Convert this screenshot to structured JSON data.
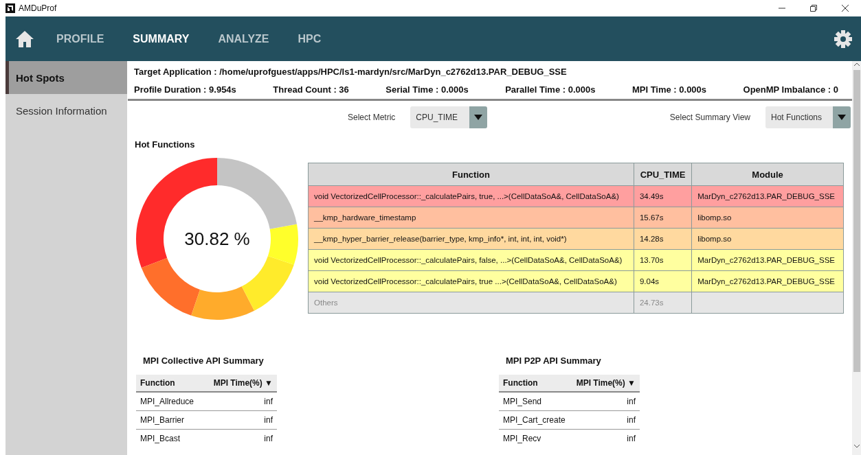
{
  "window": {
    "title": "AMDuProf"
  },
  "nav": {
    "tabs": [
      {
        "label": "PROFILE",
        "selected": false
      },
      {
        "label": "SUMMARY",
        "selected": true
      },
      {
        "label": "ANALYZE",
        "selected": false
      },
      {
        "label": "HPC",
        "selected": false
      }
    ]
  },
  "sidebar": {
    "items": [
      {
        "label": "Hot Spots",
        "selected": true
      },
      {
        "label": "Session Information",
        "selected": false
      }
    ]
  },
  "header": {
    "target": "Target Application : /home/uprofguest/apps/HPC/ls1-mardyn/src/MarDyn_c2762d13.PAR_DEBUG_SSE",
    "stats": [
      "Profile Duration : 9.954s",
      "Thread Count : 36",
      "Serial Time : 0.000s",
      "Parallel Time : 0.000s",
      "MPI Time : 0.000s",
      "OpenMP Imbalance : 0"
    ]
  },
  "metric": {
    "label": "Select Metric",
    "value": "CPU_TIME"
  },
  "summary_view": {
    "label": "Select Summary View",
    "value": "Hot Functions"
  },
  "hot_functions": {
    "title": "Hot Functions",
    "center_label": "30.82 %",
    "chart_data": {
      "type": "donut",
      "values": [
        30.82,
        14.0,
        12.76,
        12.24,
        8.08,
        22.1
      ],
      "colors": [
        "#ff2b2b",
        "#ff6f2b",
        "#ffab2b",
        "#ffeb2b",
        "#ffff2b",
        "#c4c4c4"
      ]
    },
    "table": {
      "columns": [
        "Function",
        "CPU_TIME",
        "Module"
      ],
      "rows": [
        {
          "kind": "function",
          "color": "#ff9f9f",
          "cells": [
            "void VectorizedCellProcessor::_calculatePairs, true, ...>(CellDataSoA&, CellDataSoA&)",
            "34.49s",
            "MarDyn_c2762d13.PAR_DEBUG_SSE"
          ]
        },
        {
          "kind": "function",
          "color": "#ffbf9f",
          "cells": [
            "__kmp_hardware_timestamp",
            "15.67s",
            "libomp.so"
          ]
        },
        {
          "kind": "function",
          "color": "#ffd99f",
          "cells": [
            "__kmp_hyper_barrier_release(barrier_type, kmp_info*, int, int, int, void*)",
            "14.28s",
            "libomp.so"
          ]
        },
        {
          "kind": "function",
          "color": "#ffff9f",
          "cells": [
            "void VectorizedCellProcessor::_calculatePairs, false, ...>(CellDataSoA&, CellDataSoA&)",
            "13.70s",
            "MarDyn_c2762d13.PAR_DEBUG_SSE"
          ]
        },
        {
          "kind": "function",
          "color": "#ffff9f",
          "cells": [
            "void VectorizedCellProcessor::_calculatePairs, true ...>(CellDataSoA&, CellDataSoA&)",
            "9.04s",
            "MarDyn_c2762d13.PAR_DEBUG_SSE"
          ]
        },
        {
          "kind": "others",
          "color": "#e6e6e6",
          "cells": [
            "Others",
            "24.73s",
            ""
          ]
        }
      ]
    }
  },
  "mpi_tables": [
    {
      "title": "MPI Collective API Summary",
      "columns": [
        "Function",
        "MPI Time(%) ▼"
      ],
      "rows": [
        [
          "MPI_Allreduce",
          "inf"
        ],
        [
          "MPI_Barrier",
          "inf"
        ],
        [
          "MPI_Bcast",
          "inf"
        ]
      ]
    },
    {
      "title": "MPI P2P API Summary",
      "columns": [
        "Function",
        "MPI Time(%) ▼"
      ],
      "rows": [
        [
          "MPI_Send",
          "inf"
        ],
        [
          "MPI_Cart_create",
          "inf"
        ],
        [
          "MPI_Recv",
          "inf"
        ]
      ]
    }
  ]
}
